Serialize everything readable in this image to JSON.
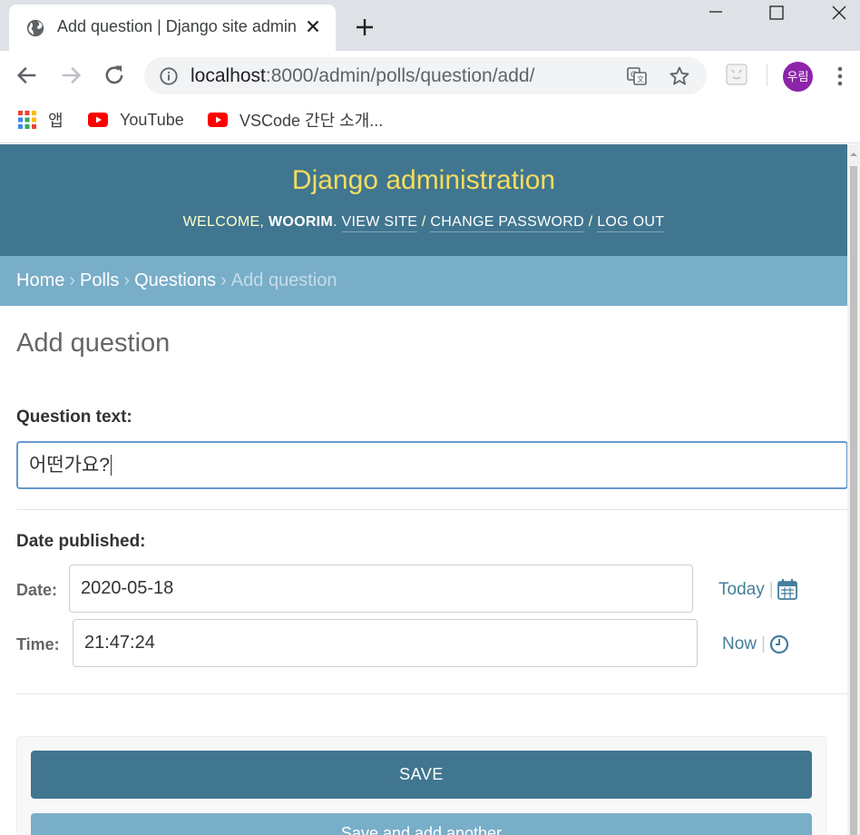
{
  "browser": {
    "tab_title": "Add question | Django site admin",
    "url_host": "localhost",
    "url_path": ":8000/admin/polls/question/add/",
    "profile_initials": "우림",
    "bookmarks": [
      {
        "label": "앱",
        "icon": "apps-grid-icon"
      },
      {
        "label": "YouTube",
        "icon": "youtube-icon"
      },
      {
        "label": "VSCode 간단 소개...",
        "icon": "youtube-icon"
      }
    ]
  },
  "header": {
    "branding": "Django administration",
    "welcome": "WELCOME,",
    "username": "WOORIM",
    "view_site": "VIEW SITE",
    "change_password": "CHANGE PASSWORD",
    "log_out": "LOG OUT"
  },
  "breadcrumbs": {
    "home": "Home",
    "polls": "Polls",
    "questions": "Questions",
    "current": "Add question"
  },
  "content": {
    "title": "Add question",
    "question_text_label": "Question text:",
    "question_text_value": "어떤가요?",
    "date_published_label": "Date published:",
    "date_label": "Date:",
    "date_value": "2020-05-18",
    "today_link": "Today",
    "time_label": "Time:",
    "time_value": "21:47:24",
    "now_link": "Now"
  },
  "submit": {
    "save": "SAVE",
    "save_and_add_another": "Save and add another"
  },
  "colors": {
    "header_bg": "#417690",
    "branding": "#f5dd5d",
    "breadcrumbs_bg": "#79aec8",
    "link": "#447e9b",
    "profile": "#8e24aa"
  }
}
